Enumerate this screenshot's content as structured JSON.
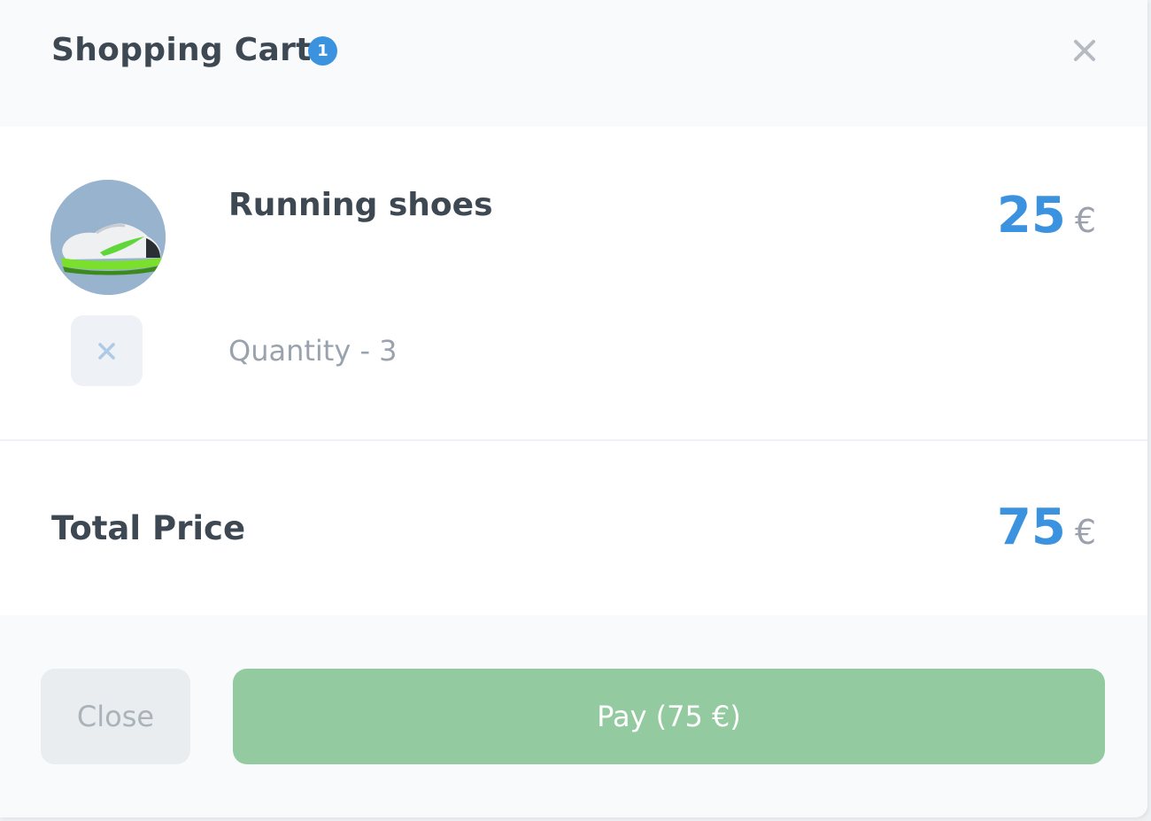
{
  "header": {
    "title": "Shopping Cart",
    "badge_count": "1",
    "close_icon": "close-icon"
  },
  "cart": {
    "items": [
      {
        "name": "Running shoes",
        "quantity_label": "Quantity - 3",
        "price": "25",
        "currency": "€",
        "image_icon": "running-shoe-image",
        "remove_icon": "remove-icon"
      }
    ]
  },
  "summary": {
    "total_label": "Total Price",
    "total": "75",
    "currency": "€"
  },
  "footer": {
    "close_label": "Close",
    "pay_label": "Pay (75 €)"
  },
  "colors": {
    "accent": "#3b93e0",
    "badge": "#3b93e0",
    "pay_button": "#93ca9f",
    "text_dark": "#3e4852",
    "text_muted": "#9aa3ad"
  }
}
